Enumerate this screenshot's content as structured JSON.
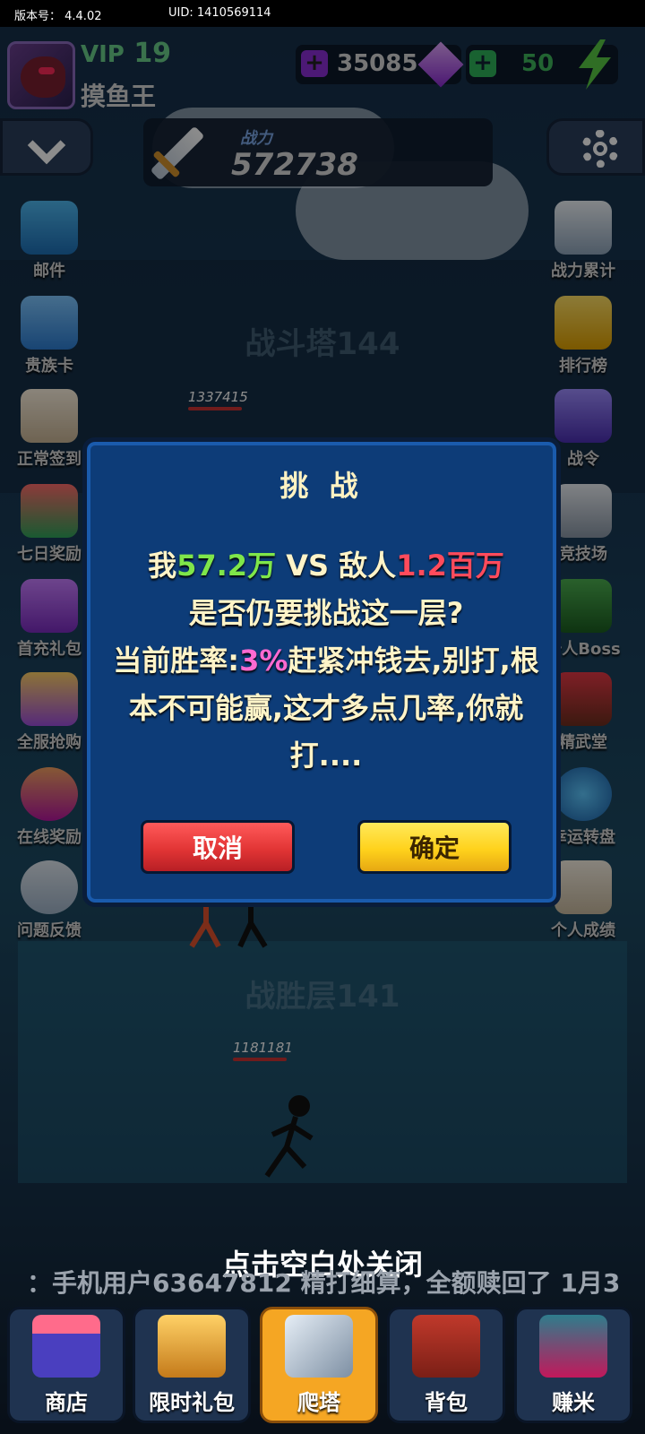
{
  "status_bar": {
    "version": "版本号：  4.4.02",
    "uid": "UID: 1410569114"
  },
  "hud": {
    "vip_label": "VIP",
    "vip_level": "19",
    "username": "摸鱼王",
    "diamonds": "35085",
    "energy": "50",
    "power_label": "战力",
    "power_value": "572738"
  },
  "tower": {
    "upper_floor": "战斗塔144",
    "upper_enemy_power": "1337415",
    "lower_floor": "战胜层141",
    "lower_enemy_power": "1181181"
  },
  "left_menu": [
    {
      "label": "邮件",
      "icon": "mail-icon"
    },
    {
      "label": "贵族卡",
      "icon": "noble-card-icon"
    },
    {
      "label": "正常签到",
      "icon": "scroll-icon"
    },
    {
      "label": "七日奖励",
      "icon": "gift-icon"
    },
    {
      "label": "首充礼包",
      "icon": "gift-box-icon"
    },
    {
      "label": "全服抢购",
      "icon": "treasure-icon"
    },
    {
      "label": "在线奖励",
      "icon": "stopwatch-icon"
    },
    {
      "label": "问题反馈",
      "icon": "chat-bubble-icon"
    }
  ],
  "right_menu": [
    {
      "label": "战力累计",
      "icon": "sword-icon"
    },
    {
      "label": "排行榜",
      "icon": "trophy-icon"
    },
    {
      "label": "战令",
      "icon": "book-icon"
    },
    {
      "label": "竞技场",
      "icon": "arena-icon"
    },
    {
      "label": "千人Boss",
      "icon": "boss-gate-icon"
    },
    {
      "label": "精武堂",
      "icon": "dojo-icon"
    },
    {
      "label": "幸运转盘",
      "icon": "wheel-icon"
    },
    {
      "label": "个人成绩",
      "icon": "record-icon"
    }
  ],
  "dialog": {
    "title": "挑 战",
    "line1_me": "我",
    "my_power": "57.2万",
    "vs": " VS 敌人",
    "enemy_power": "1.2百万",
    "line2": "是否仍要挑战这一层?",
    "line3_prefix": "当前胜率:",
    "win_rate": "3%",
    "line3_suffix": "赶紧冲钱去,别打,根本不可能赢,这才多点几率,你就打....",
    "cancel": "取消",
    "confirm": "确定"
  },
  "close_hint": "点击空白处关闭",
  "ticker": "：手机用户63647812 精打细算，全额赎回了 1月3",
  "bottom_nav": [
    {
      "label": "商店",
      "icon": "shop-icon"
    },
    {
      "label": "限时礼包",
      "icon": "treasure-chest-icon"
    },
    {
      "label": "爬塔",
      "icon": "crossed-swords-icon"
    },
    {
      "label": "背包",
      "icon": "backpack-icon"
    },
    {
      "label": "赚米",
      "icon": "real-world-icon"
    }
  ],
  "colors": {
    "dialog_bg": "#0d3c78",
    "cancel": "#e23535",
    "confirm": "#ffd21c",
    "accent_green": "#7fe64a",
    "accent_red": "#ff4b5c",
    "accent_pink": "#ff6ad1"
  }
}
